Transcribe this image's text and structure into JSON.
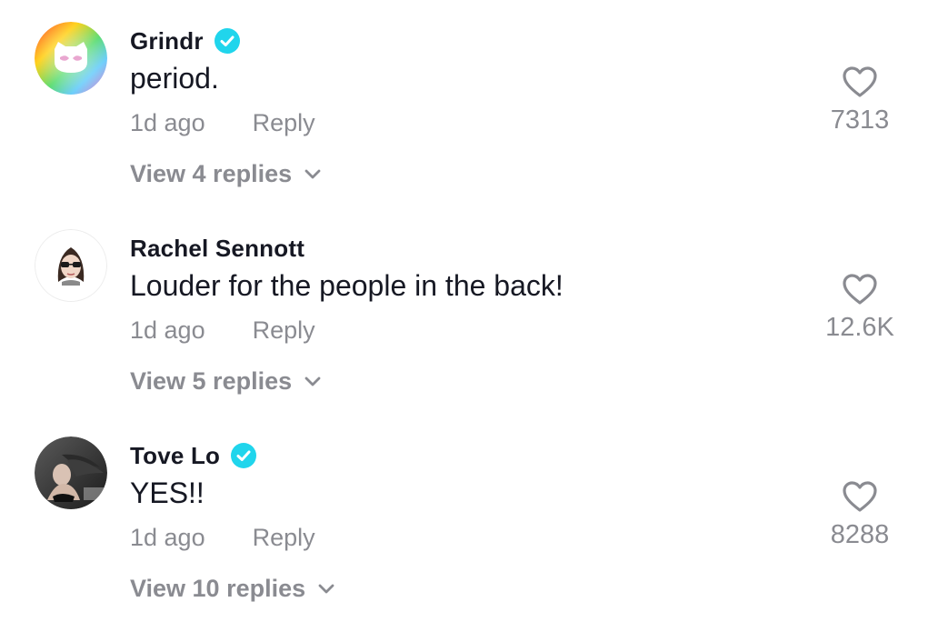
{
  "comments": [
    {
      "username": "Grindr",
      "verified": true,
      "text": "period.",
      "time": "1d ago",
      "reply_label": "Reply",
      "likes": "7313",
      "view_replies": "View 4 replies",
      "avatar": "grindr-logo"
    },
    {
      "username": "Rachel Sennott",
      "verified": false,
      "text": "Louder for the people in the back!",
      "time": "1d ago",
      "reply_label": "Reply",
      "likes": "12.6K",
      "view_replies": "View 5 replies",
      "avatar": "user-photo"
    },
    {
      "username": "Tove Lo",
      "verified": true,
      "text": "YES!!",
      "time": "1d ago",
      "reply_label": "Reply",
      "likes": "8288",
      "view_replies": "View 10 replies",
      "avatar": "user-photo"
    }
  ],
  "colors": {
    "primary_text": "#161823",
    "secondary_text": "#8a8b91",
    "verified": "#20d5ec"
  },
  "icons": {
    "like": "heart-outline-icon",
    "verified": "verified-badge-icon",
    "expand": "chevron-down-icon"
  }
}
